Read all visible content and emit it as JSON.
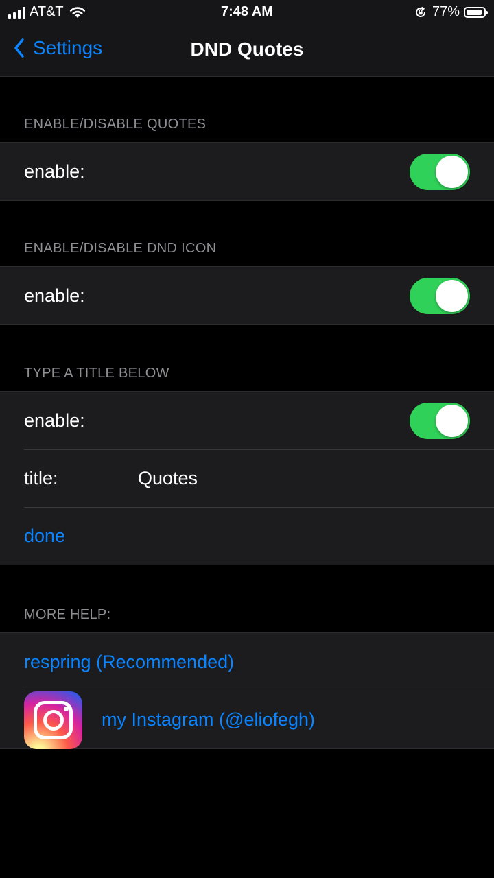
{
  "status_bar": {
    "carrier": "AT&T",
    "time": "7:48 AM",
    "battery_percent": "77%",
    "battery_level": 0.77
  },
  "nav": {
    "back_label": "Settings",
    "title": "DND Quotes"
  },
  "sections": {
    "quotes": {
      "header": "ENABLE/DISABLE QUOTES",
      "enable_label": "enable:",
      "enabled": true
    },
    "dnd_icon": {
      "header": "ENABLE/DISABLE DND ICON",
      "enable_label": "enable:",
      "enabled": true
    },
    "title": {
      "header": "TYPE A TITLE BELOW",
      "enable_label": "enable:",
      "enabled": true,
      "title_label": "title:",
      "title_value": "Quotes",
      "done_label": "done"
    },
    "help": {
      "header": "MORE HELP:",
      "respring_label": "respring (Recommended)",
      "instagram_label": "my Instagram (@eliofegh)"
    }
  },
  "colors": {
    "accent": "#0a84ff",
    "toggle_on": "#30d158",
    "background": "#000000",
    "cell": "#1c1c1e",
    "secondary_text": "#8e8e93"
  },
  "icons": {
    "back": "chevron-left-icon",
    "instagram": "instagram-icon",
    "signal": "cellular-signal-icon",
    "wifi": "wifi-icon",
    "orientation_lock": "orientation-lock-icon",
    "battery": "battery-icon"
  }
}
